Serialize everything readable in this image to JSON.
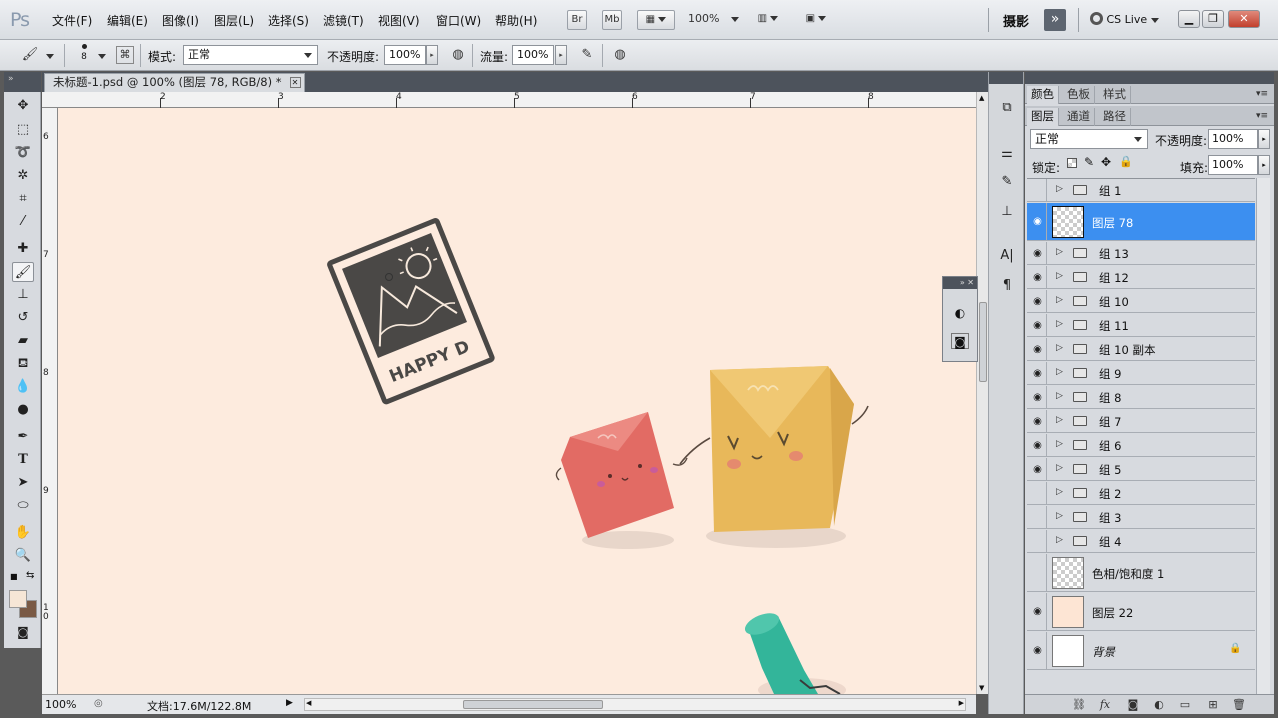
{
  "app": {
    "logo": "Ps"
  },
  "menubar": {
    "items": [
      "文件(F)",
      "编辑(E)",
      "图像(I)",
      "图层(L)",
      "选择(S)",
      "滤镜(T)",
      "视图(V)",
      "窗口(W)",
      "帮助(H)"
    ],
    "bridge": "Br",
    "minibridge": "Mb",
    "zoom": "100%",
    "workspace": "摄影",
    "cslive": "CS Live"
  },
  "options": {
    "brush_size": "8",
    "mode_label": "模式:",
    "mode_value": "正常",
    "opacity_label": "不透明度:",
    "opacity_value": "100%",
    "flow_label": "流量:",
    "flow_value": "100%"
  },
  "document": {
    "tab_title": "未标题-1.psd @ 100% (图层 78, RGB/8) *",
    "ruler_top": [
      "2",
      "3",
      "4",
      "5",
      "6",
      "7",
      "8"
    ],
    "ruler_left": [
      "6",
      "7",
      "8",
      "9",
      "1\n0"
    ],
    "stamp_text": "HAPPY D",
    "canvas_color": "#fdebde"
  },
  "status": {
    "zoom": "100%",
    "doc_size": "文档:17.6M/122.8M"
  },
  "panels": {
    "top_tabs": [
      "颜色",
      "色板",
      "样式"
    ],
    "layer_tabs": [
      "图层",
      "通道",
      "路径"
    ],
    "blend_mode": "正常",
    "opacity_label": "不透明度:",
    "opacity_value": "100%",
    "lock_label": "锁定:",
    "fill_label": "填充:",
    "fill_value": "100%"
  },
  "layers": [
    {
      "name": "组 1",
      "type": "group",
      "visible": false
    },
    {
      "name": "图层 78",
      "type": "layer",
      "visible": true,
      "selected": true
    },
    {
      "name": "组 13",
      "type": "group",
      "visible": true
    },
    {
      "name": "组 12",
      "type": "group",
      "visible": true
    },
    {
      "name": "组 10",
      "type": "group",
      "visible": true
    },
    {
      "name": "组 11",
      "type": "group",
      "visible": true
    },
    {
      "name": "组 10 副本",
      "type": "group",
      "visible": true
    },
    {
      "name": "组 9",
      "type": "group",
      "visible": true
    },
    {
      "name": "组 8",
      "type": "group",
      "visible": true
    },
    {
      "name": "组 7",
      "type": "group",
      "visible": true
    },
    {
      "name": "组 6",
      "type": "group",
      "visible": true
    },
    {
      "name": "组 5",
      "type": "group",
      "visible": true
    },
    {
      "name": "组 2",
      "type": "group",
      "visible": false
    },
    {
      "name": "组 3",
      "type": "group",
      "visible": false
    },
    {
      "name": "组 4",
      "type": "group",
      "visible": false
    },
    {
      "name": "色相/饱和度 1",
      "type": "adjustment",
      "visible": false
    },
    {
      "name": "图层 22",
      "type": "layer",
      "visible": true,
      "thumb_color": "#fde5d4"
    },
    {
      "name": "背景",
      "type": "background",
      "visible": true,
      "locked": true
    }
  ],
  "colors": {
    "foreground": "#f6e6d6",
    "background": "#7a5a45",
    "selection": "#3c8ff0"
  }
}
